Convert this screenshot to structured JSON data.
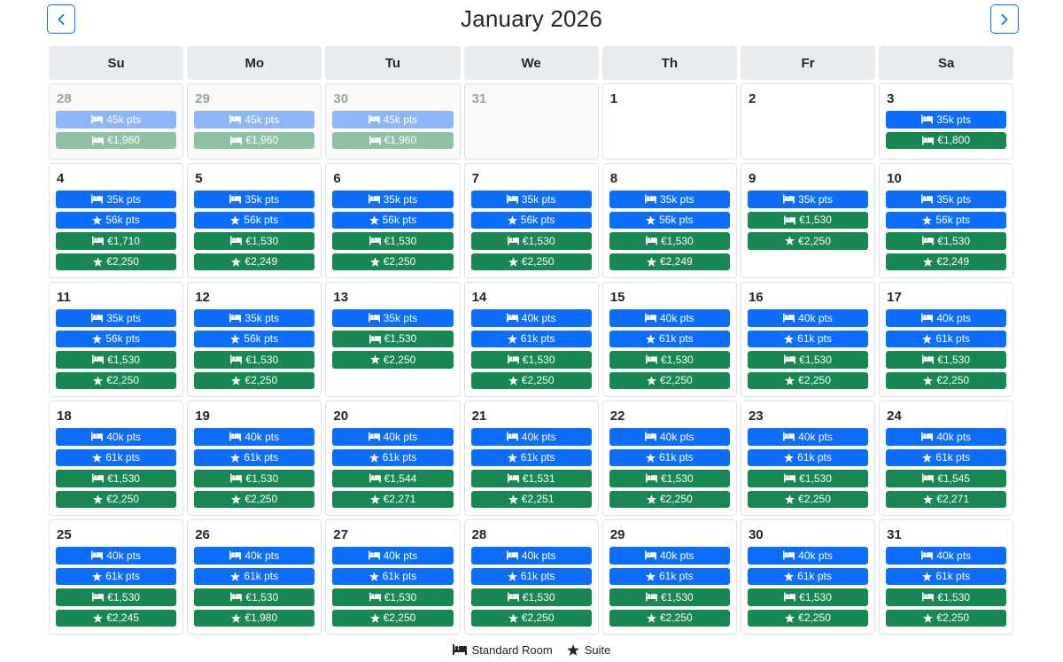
{
  "header": {
    "title": "January 2026",
    "prev_icon": "chevron-left-icon",
    "next_icon": "chevron-right-icon"
  },
  "weekdays": [
    "Su",
    "Mo",
    "Tu",
    "We",
    "Th",
    "Fr",
    "Sa"
  ],
  "colors": {
    "points": "#0d6efd",
    "cash": "#198754",
    "points_faded": "#8fb6f9",
    "cash_faded": "#8fc1a5"
  },
  "days": [
    {
      "day": "28",
      "other": true,
      "rates": [
        {
          "type": "pts",
          "icon": "bed",
          "label": "45k pts"
        },
        {
          "type": "cash",
          "icon": "bed",
          "label": "€1,960"
        }
      ]
    },
    {
      "day": "29",
      "other": true,
      "rates": [
        {
          "type": "pts",
          "icon": "bed",
          "label": "45k pts"
        },
        {
          "type": "cash",
          "icon": "bed",
          "label": "€1,960"
        }
      ]
    },
    {
      "day": "30",
      "other": true,
      "rates": [
        {
          "type": "pts",
          "icon": "bed",
          "label": "45k pts"
        },
        {
          "type": "cash",
          "icon": "bed",
          "label": "€1,960"
        }
      ]
    },
    {
      "day": "31",
      "other": true,
      "rates": []
    },
    {
      "day": "1",
      "other": false,
      "rates": []
    },
    {
      "day": "2",
      "other": false,
      "rates": []
    },
    {
      "day": "3",
      "other": false,
      "rates": [
        {
          "type": "pts",
          "icon": "bed",
          "label": "35k pts"
        },
        {
          "type": "cash",
          "icon": "bed",
          "label": "€1,800"
        }
      ]
    },
    {
      "day": "4",
      "other": false,
      "rates": [
        {
          "type": "pts",
          "icon": "bed",
          "label": "35k pts"
        },
        {
          "type": "pts",
          "icon": "star",
          "label": "56k pts"
        },
        {
          "type": "cash",
          "icon": "bed",
          "label": "€1,710"
        },
        {
          "type": "cash",
          "icon": "star",
          "label": "€2,250"
        }
      ]
    },
    {
      "day": "5",
      "other": false,
      "rates": [
        {
          "type": "pts",
          "icon": "bed",
          "label": "35k pts"
        },
        {
          "type": "pts",
          "icon": "star",
          "label": "56k pts"
        },
        {
          "type": "cash",
          "icon": "bed",
          "label": "€1,530"
        },
        {
          "type": "cash",
          "icon": "star",
          "label": "€2,249"
        }
      ]
    },
    {
      "day": "6",
      "other": false,
      "rates": [
        {
          "type": "pts",
          "icon": "bed",
          "label": "35k pts"
        },
        {
          "type": "pts",
          "icon": "star",
          "label": "56k pts"
        },
        {
          "type": "cash",
          "icon": "bed",
          "label": "€1,530"
        },
        {
          "type": "cash",
          "icon": "star",
          "label": "€2,250"
        }
      ]
    },
    {
      "day": "7",
      "other": false,
      "rates": [
        {
          "type": "pts",
          "icon": "bed",
          "label": "35k pts"
        },
        {
          "type": "pts",
          "icon": "star",
          "label": "56k pts"
        },
        {
          "type": "cash",
          "icon": "bed",
          "label": "€1,530"
        },
        {
          "type": "cash",
          "icon": "star",
          "label": "€2,250"
        }
      ]
    },
    {
      "day": "8",
      "other": false,
      "rates": [
        {
          "type": "pts",
          "icon": "bed",
          "label": "35k pts"
        },
        {
          "type": "pts",
          "icon": "star",
          "label": "56k pts"
        },
        {
          "type": "cash",
          "icon": "bed",
          "label": "€1,530"
        },
        {
          "type": "cash",
          "icon": "star",
          "label": "€2,249"
        }
      ]
    },
    {
      "day": "9",
      "other": false,
      "rates": [
        {
          "type": "pts",
          "icon": "bed",
          "label": "35k pts"
        },
        {
          "type": "cash",
          "icon": "bed",
          "label": "€1,530"
        },
        {
          "type": "cash",
          "icon": "star",
          "label": "€2,250"
        }
      ]
    },
    {
      "day": "10",
      "other": false,
      "rates": [
        {
          "type": "pts",
          "icon": "bed",
          "label": "35k pts"
        },
        {
          "type": "pts",
          "icon": "star",
          "label": "56k pts"
        },
        {
          "type": "cash",
          "icon": "bed",
          "label": "€1,530"
        },
        {
          "type": "cash",
          "icon": "star",
          "label": "€2,249"
        }
      ]
    },
    {
      "day": "11",
      "other": false,
      "rates": [
        {
          "type": "pts",
          "icon": "bed",
          "label": "35k pts"
        },
        {
          "type": "pts",
          "icon": "star",
          "label": "56k pts"
        },
        {
          "type": "cash",
          "icon": "bed",
          "label": "€1,530"
        },
        {
          "type": "cash",
          "icon": "star",
          "label": "€2,250"
        }
      ]
    },
    {
      "day": "12",
      "other": false,
      "rates": [
        {
          "type": "pts",
          "icon": "bed",
          "label": "35k pts"
        },
        {
          "type": "pts",
          "icon": "star",
          "label": "56k pts"
        },
        {
          "type": "cash",
          "icon": "bed",
          "label": "€1,530"
        },
        {
          "type": "cash",
          "icon": "star",
          "label": "€2,250"
        }
      ]
    },
    {
      "day": "13",
      "other": false,
      "rates": [
        {
          "type": "pts",
          "icon": "bed",
          "label": "35k pts"
        },
        {
          "type": "cash",
          "icon": "bed",
          "label": "€1,530"
        },
        {
          "type": "cash",
          "icon": "star",
          "label": "€2,250"
        }
      ]
    },
    {
      "day": "14",
      "other": false,
      "rates": [
        {
          "type": "pts",
          "icon": "bed",
          "label": "40k pts"
        },
        {
          "type": "pts",
          "icon": "star",
          "label": "61k pts"
        },
        {
          "type": "cash",
          "icon": "bed",
          "label": "€1,530"
        },
        {
          "type": "cash",
          "icon": "star",
          "label": "€2,250"
        }
      ]
    },
    {
      "day": "15",
      "other": false,
      "rates": [
        {
          "type": "pts",
          "icon": "bed",
          "label": "40k pts"
        },
        {
          "type": "pts",
          "icon": "star",
          "label": "61k pts"
        },
        {
          "type": "cash",
          "icon": "bed",
          "label": "€1,530"
        },
        {
          "type": "cash",
          "icon": "star",
          "label": "€2,250"
        }
      ]
    },
    {
      "day": "16",
      "other": false,
      "rates": [
        {
          "type": "pts",
          "icon": "bed",
          "label": "40k pts"
        },
        {
          "type": "pts",
          "icon": "star",
          "label": "61k pts"
        },
        {
          "type": "cash",
          "icon": "bed",
          "label": "€1,530"
        },
        {
          "type": "cash",
          "icon": "star",
          "label": "€2,250"
        }
      ]
    },
    {
      "day": "17",
      "other": false,
      "rates": [
        {
          "type": "pts",
          "icon": "bed",
          "label": "40k pts"
        },
        {
          "type": "pts",
          "icon": "star",
          "label": "61k pts"
        },
        {
          "type": "cash",
          "icon": "bed",
          "label": "€1,530"
        },
        {
          "type": "cash",
          "icon": "star",
          "label": "€2,250"
        }
      ]
    },
    {
      "day": "18",
      "other": false,
      "rates": [
        {
          "type": "pts",
          "icon": "bed",
          "label": "40k pts"
        },
        {
          "type": "pts",
          "icon": "star",
          "label": "61k pts"
        },
        {
          "type": "cash",
          "icon": "bed",
          "label": "€1,530"
        },
        {
          "type": "cash",
          "icon": "star",
          "label": "€2,250"
        }
      ]
    },
    {
      "day": "19",
      "other": false,
      "rates": [
        {
          "type": "pts",
          "icon": "bed",
          "label": "40k pts"
        },
        {
          "type": "pts",
          "icon": "star",
          "label": "61k pts"
        },
        {
          "type": "cash",
          "icon": "bed",
          "label": "€1,530"
        },
        {
          "type": "cash",
          "icon": "star",
          "label": "€2,250"
        }
      ]
    },
    {
      "day": "20",
      "other": false,
      "rates": [
        {
          "type": "pts",
          "icon": "bed",
          "label": "40k pts"
        },
        {
          "type": "pts",
          "icon": "star",
          "label": "61k pts"
        },
        {
          "type": "cash",
          "icon": "bed",
          "label": "€1,544"
        },
        {
          "type": "cash",
          "icon": "star",
          "label": "€2,271"
        }
      ]
    },
    {
      "day": "21",
      "other": false,
      "rates": [
        {
          "type": "pts",
          "icon": "bed",
          "label": "40k pts"
        },
        {
          "type": "pts",
          "icon": "star",
          "label": "61k pts"
        },
        {
          "type": "cash",
          "icon": "bed",
          "label": "€1,531"
        },
        {
          "type": "cash",
          "icon": "star",
          "label": "€2,251"
        }
      ]
    },
    {
      "day": "22",
      "other": false,
      "rates": [
        {
          "type": "pts",
          "icon": "bed",
          "label": "40k pts"
        },
        {
          "type": "pts",
          "icon": "star",
          "label": "61k pts"
        },
        {
          "type": "cash",
          "icon": "bed",
          "label": "€1,530"
        },
        {
          "type": "cash",
          "icon": "star",
          "label": "€2,250"
        }
      ]
    },
    {
      "day": "23",
      "other": false,
      "rates": [
        {
          "type": "pts",
          "icon": "bed",
          "label": "40k pts"
        },
        {
          "type": "pts",
          "icon": "star",
          "label": "61k pts"
        },
        {
          "type": "cash",
          "icon": "bed",
          "label": "€1,530"
        },
        {
          "type": "cash",
          "icon": "star",
          "label": "€2,250"
        }
      ]
    },
    {
      "day": "24",
      "other": false,
      "rates": [
        {
          "type": "pts",
          "icon": "bed",
          "label": "40k pts"
        },
        {
          "type": "pts",
          "icon": "star",
          "label": "61k pts"
        },
        {
          "type": "cash",
          "icon": "bed",
          "label": "€1,545"
        },
        {
          "type": "cash",
          "icon": "star",
          "label": "€2,271"
        }
      ]
    },
    {
      "day": "25",
      "other": false,
      "rates": [
        {
          "type": "pts",
          "icon": "bed",
          "label": "40k pts"
        },
        {
          "type": "pts",
          "icon": "star",
          "label": "61k pts"
        },
        {
          "type": "cash",
          "icon": "bed",
          "label": "€1,530"
        },
        {
          "type": "cash",
          "icon": "star",
          "label": "€2,245"
        }
      ]
    },
    {
      "day": "26",
      "other": false,
      "rates": [
        {
          "type": "pts",
          "icon": "bed",
          "label": "40k pts"
        },
        {
          "type": "pts",
          "icon": "star",
          "label": "61k pts"
        },
        {
          "type": "cash",
          "icon": "bed",
          "label": "€1,530"
        },
        {
          "type": "cash",
          "icon": "star",
          "label": "€1,980"
        }
      ]
    },
    {
      "day": "27",
      "other": false,
      "rates": [
        {
          "type": "pts",
          "icon": "bed",
          "label": "40k pts"
        },
        {
          "type": "pts",
          "icon": "star",
          "label": "61k pts"
        },
        {
          "type": "cash",
          "icon": "bed",
          "label": "€1,530"
        },
        {
          "type": "cash",
          "icon": "star",
          "label": "€2,250"
        }
      ]
    },
    {
      "day": "28",
      "other": false,
      "rates": [
        {
          "type": "pts",
          "icon": "bed",
          "label": "40k pts"
        },
        {
          "type": "pts",
          "icon": "star",
          "label": "61k pts"
        },
        {
          "type": "cash",
          "icon": "bed",
          "label": "€1,530"
        },
        {
          "type": "cash",
          "icon": "star",
          "label": "€2,250"
        }
      ]
    },
    {
      "day": "29",
      "other": false,
      "rates": [
        {
          "type": "pts",
          "icon": "bed",
          "label": "40k pts"
        },
        {
          "type": "pts",
          "icon": "star",
          "label": "61k pts"
        },
        {
          "type": "cash",
          "icon": "bed",
          "label": "€1,530"
        },
        {
          "type": "cash",
          "icon": "star",
          "label": "€2,250"
        }
      ]
    },
    {
      "day": "30",
      "other": false,
      "rates": [
        {
          "type": "pts",
          "icon": "bed",
          "label": "40k pts"
        },
        {
          "type": "pts",
          "icon": "star",
          "label": "61k pts"
        },
        {
          "type": "cash",
          "icon": "bed",
          "label": "€1,530"
        },
        {
          "type": "cash",
          "icon": "star",
          "label": "€2,250"
        }
      ]
    },
    {
      "day": "31",
      "other": false,
      "rates": [
        {
          "type": "pts",
          "icon": "bed",
          "label": "40k pts"
        },
        {
          "type": "pts",
          "icon": "star",
          "label": "61k pts"
        },
        {
          "type": "cash",
          "icon": "bed",
          "label": "€1,530"
        },
        {
          "type": "cash",
          "icon": "star",
          "label": "€2,250"
        }
      ]
    }
  ],
  "legend": {
    "standard_label": "Standard Room",
    "standard_icon": "bed-icon",
    "suite_label": "Suite",
    "suite_icon": "star-icon"
  }
}
